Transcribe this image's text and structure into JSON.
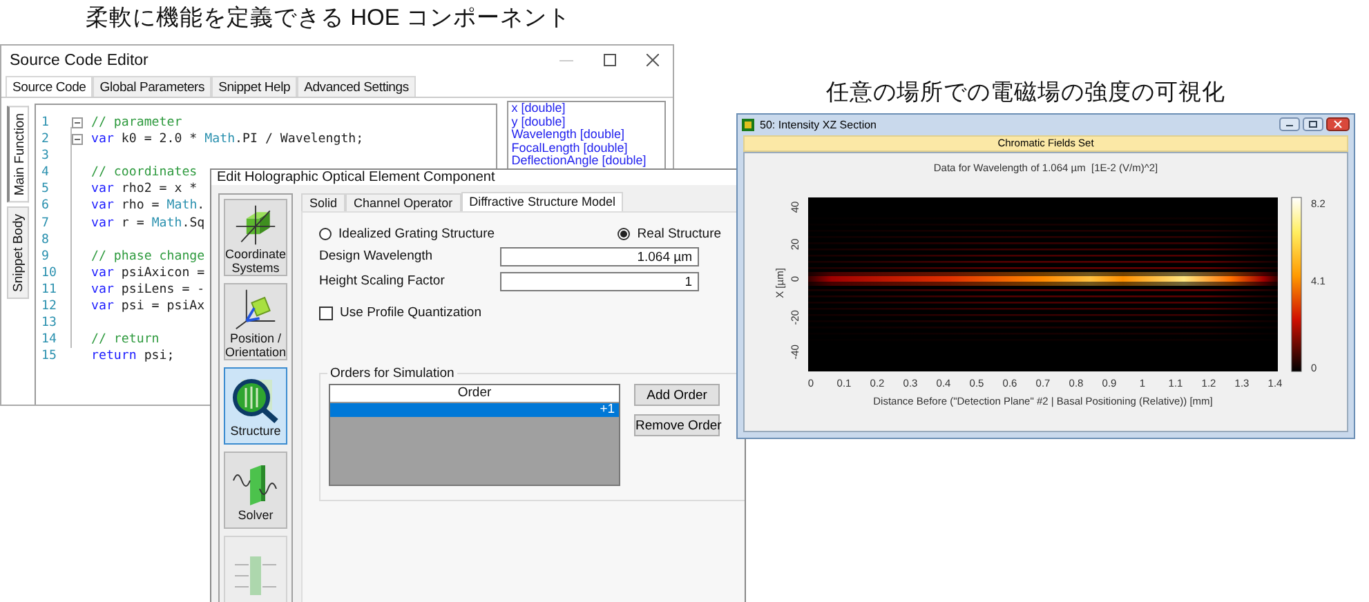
{
  "headings": [
    {
      "text": "柔軟に機能を定義できる HOE コンポーネント"
    },
    {
      "text": "任意の場所での電磁場の強度の可視化"
    }
  ],
  "editor": {
    "title": "Source Code Editor",
    "tabs": [
      {
        "label": "Source Code",
        "selected": true
      },
      {
        "label": "Global Parameters",
        "selected": false
      },
      {
        "label": "Snippet Help",
        "selected": false
      },
      {
        "label": "Advanced Settings",
        "selected": false
      }
    ],
    "side_tabs": [
      {
        "label": "Main Function",
        "selected": true
      },
      {
        "label": "Snippet Body",
        "selected": false
      }
    ],
    "lines": [
      {
        "number": "1",
        "fold": true,
        "tokens": [
          {
            "kind": "comment",
            "text": "// parameter"
          }
        ]
      },
      {
        "number": "2",
        "fold": true,
        "tokens": [
          {
            "kind": "keyword",
            "text": "var"
          },
          {
            "kind": "plain",
            "text": " k0 = 2.0 * "
          },
          {
            "kind": "type",
            "text": "Math"
          },
          {
            "kind": "plain",
            "text": ".PI / Wavelength;"
          }
        ]
      },
      {
        "number": "3",
        "fold": false
      },
      {
        "number": "4",
        "fold": false,
        "tokens": [
          {
            "kind": "comment",
            "text": "// coordinates"
          }
        ]
      },
      {
        "number": "5",
        "fold": false,
        "tokens": [
          {
            "kind": "keyword",
            "text": "var"
          },
          {
            "kind": "plain",
            "text": " rho2 = x *"
          }
        ]
      },
      {
        "number": "6",
        "fold": false,
        "tokens": [
          {
            "kind": "keyword",
            "text": "var"
          },
          {
            "kind": "plain",
            "text": " rho = "
          },
          {
            "kind": "type",
            "text": "Math"
          },
          {
            "kind": "plain",
            "text": "."
          }
        ]
      },
      {
        "number": "7",
        "fold": false,
        "tokens": [
          {
            "kind": "keyword",
            "text": "var"
          },
          {
            "kind": "plain",
            "text": " r = "
          },
          {
            "kind": "type",
            "text": "Math"
          },
          {
            "kind": "plain",
            "text": ".Sq"
          }
        ]
      },
      {
        "number": "8",
        "fold": false
      },
      {
        "number": "9",
        "fold": false,
        "tokens": [
          {
            "kind": "comment",
            "text": "// phase change"
          }
        ]
      },
      {
        "number": "10",
        "fold": false,
        "tokens": [
          {
            "kind": "keyword",
            "text": "var"
          },
          {
            "kind": "plain",
            "text": " psiAxicon ="
          }
        ]
      },
      {
        "number": "11",
        "fold": false,
        "tokens": [
          {
            "kind": "keyword",
            "text": "var"
          },
          {
            "kind": "plain",
            "text": " psiLens = -"
          }
        ]
      },
      {
        "number": "12",
        "fold": false,
        "tokens": [
          {
            "kind": "keyword",
            "text": "var"
          },
          {
            "kind": "plain",
            "text": " psi = psiAx"
          }
        ]
      },
      {
        "number": "13",
        "fold": false
      },
      {
        "number": "14",
        "fold": false,
        "tokens": [
          {
            "kind": "comment",
            "text": "// return"
          }
        ]
      },
      {
        "number": "15",
        "fold": false,
        "tokens": [
          {
            "kind": "keyword",
            "text": "return"
          },
          {
            "kind": "plain",
            "text": " psi;"
          }
        ]
      }
    ],
    "variables": [
      "x [double]",
      "y [double]",
      "Wavelength [double]",
      "FocalLength [double]",
      "DeflectionAngle [double]"
    ]
  },
  "dialog": {
    "title": "Edit Holographic Optical Element Component",
    "nav": [
      {
        "label": "Coordinate Systems",
        "kind": "cube",
        "selected": false,
        "disabled": false
      },
      {
        "label": "Position / Orientation",
        "kind": "axes",
        "selected": false,
        "disabled": false
      },
      {
        "label": "Structure",
        "kind": "magnifier",
        "selected": true,
        "disabled": false
      },
      {
        "label": "Solver",
        "kind": "wave",
        "selected": false,
        "disabled": false
      },
      {
        "kind": "arrows",
        "selected": false,
        "disabled": true
      }
    ],
    "tabs": [
      {
        "label": "Solid",
        "selected": false
      },
      {
        "label": "Channel Operator",
        "selected": false
      },
      {
        "label": "Diffractive Structure Model",
        "selected": true
      }
    ],
    "radios": [
      {
        "label": "Idealized Grating Structure",
        "selected": false
      },
      {
        "label": "Real Structure",
        "selected": true
      }
    ],
    "fields": [
      {
        "label": "Design Wavelength",
        "value": "1.064 µm"
      },
      {
        "label": "Height Scaling Factor",
        "value": "1"
      }
    ],
    "checkbox": {
      "label": "Use Profile Quantization",
      "checked": false
    },
    "orders": {
      "title": "Orders for Simulation",
      "column": "Order",
      "rows": [
        {
          "value": "+1",
          "selected": true
        }
      ],
      "buttons": [
        "Add Order",
        "Remove Order"
      ]
    }
  },
  "chart_window": {
    "title": "50: Intensity XZ Section",
    "banner": "Chromatic Fields Set",
    "plot_title": "Data for Wavelength of 1.064 µm  [1E-2 (V/m)^2]",
    "ylabel": "X [µm]",
    "yticks": [
      "40",
      "20",
      "0",
      "-20",
      "-40"
    ],
    "xticks": [
      "0",
      "0.1",
      "0.2",
      "0.3",
      "0.4",
      "0.5",
      "0.6",
      "0.7",
      "0.8",
      "0.9",
      "1",
      "1.1",
      "1.2",
      "1.3",
      "1.4"
    ],
    "xlabel": "Distance Before (\"Detection Plane\" #2 | Basal Positioning (Relative)) [mm]",
    "colorbar_ticks": [
      "8.2",
      "4.1",
      "0"
    ]
  }
}
